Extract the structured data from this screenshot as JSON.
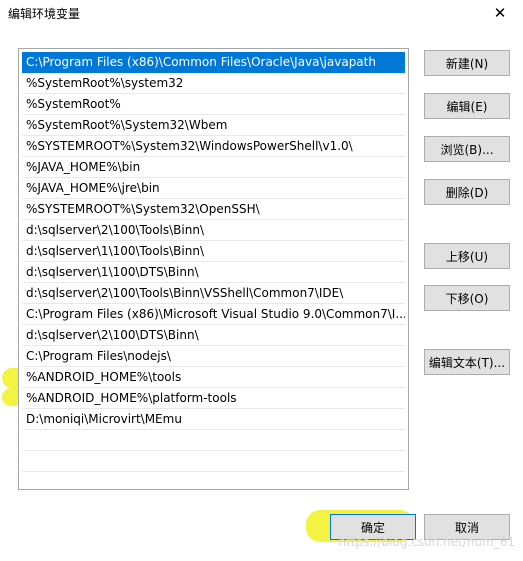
{
  "window": {
    "title": "编辑环境变量",
    "close_glyph": "✕"
  },
  "path_list": {
    "selected_index": 0,
    "items": [
      "C:\\Program Files (x86)\\Common Files\\Oracle\\Java\\javapath",
      "%SystemRoot%\\system32",
      "%SystemRoot%",
      "%SystemRoot%\\System32\\Wbem",
      "%SYSTEMROOT%\\System32\\WindowsPowerShell\\v1.0\\",
      "%JAVA_HOME%\\bin",
      "%JAVA_HOME%\\jre\\bin",
      "%SYSTEMROOT%\\System32\\OpenSSH\\",
      "d:\\sqlserver\\2\\100\\Tools\\Binn\\",
      "d:\\sqlserver\\1\\100\\Tools\\Binn\\",
      "d:\\sqlserver\\1\\100\\DTS\\Binn\\",
      "d:\\sqlserver\\2\\100\\Tools\\Binn\\VSShell\\Common7\\IDE\\",
      "C:\\Program Files (x86)\\Microsoft Visual Studio 9.0\\Common7\\I...",
      "d:\\sqlserver\\2\\100\\DTS\\Binn\\",
      "C:\\Program Files\\nodejs\\",
      "%ANDROID_HOME%\\tools",
      "%ANDROID_HOME%\\platform-tools",
      "D:\\moniqi\\Microvirt\\MEmu"
    ],
    "empty_rows": 3
  },
  "side_buttons": {
    "new": "新建(N)",
    "edit": "编辑(E)",
    "browse": "浏览(B)...",
    "delete": "删除(D)",
    "move_up": "上移(U)",
    "move_down": "下移(O)",
    "edit_text": "编辑文本(T)..."
  },
  "footer": {
    "ok": "确定",
    "cancel": "取消"
  },
  "highlight_color": "#f2f230",
  "selection_color": "#0078d7",
  "watermark": "https://blog.csdn.net/num_61"
}
